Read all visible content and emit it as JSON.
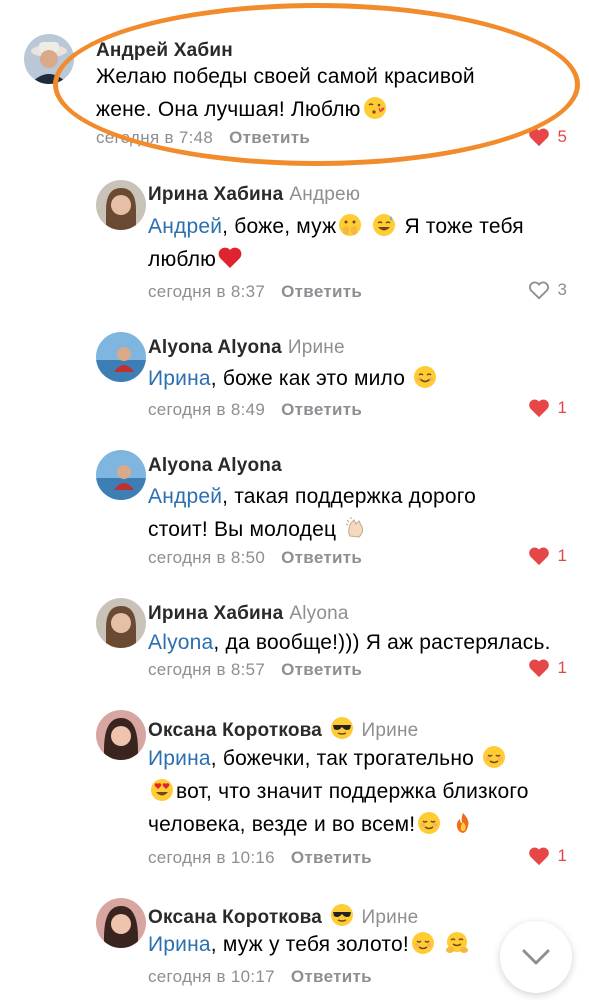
{
  "comments": [
    {
      "author": "Андрей Хабин",
      "reply_to": "",
      "mention": "",
      "text_parts": [
        "Желаю победы своей самой красивой",
        "жене. Она лучшая! Люблю"
      ],
      "time": "сегодня в 7:48",
      "reply_label": "Ответить",
      "likes": "5",
      "liked": true
    },
    {
      "author": "Ирина Хабина",
      "reply_to": "Андрею",
      "mention": "Андрей",
      "text_a": ", боже, муж",
      "text_b": "Я тоже тебя",
      "text_c": "люблю",
      "time": "сегодня в 8:37",
      "reply_label": "Ответить",
      "likes": "3",
      "liked": false
    },
    {
      "author": "Alyona Alyona",
      "reply_to": "Ирине",
      "mention": "Ирина",
      "text_a": ", боже как это мило",
      "time": "сегодня в 8:49",
      "reply_label": "Ответить",
      "likes": "1",
      "liked": true
    },
    {
      "author": "Alyona Alyona",
      "reply_to": "",
      "mention": "Андрей",
      "text_a": ", такая поддержка дорого",
      "text_b": "стоит! Вы молодец",
      "time": "сегодня в 8:50",
      "reply_label": "Ответить",
      "likes": "1",
      "liked": true
    },
    {
      "author": "Ирина Хабина",
      "reply_to": "Alyona",
      "mention": "Alyona",
      "text_a": ", да вообще!))) Я аж растерялась.",
      "time": "сегодня в 8:57",
      "reply_label": "Ответить",
      "likes": "1",
      "liked": true
    },
    {
      "author": "Оксана Короткова",
      "reply_to": "Ирине",
      "mention": "Ирина",
      "text_a": ", божечки, так трогательно",
      "text_b": "вот, что значит поддержка близкого",
      "text_c": "человека, везде и во всем!",
      "time": "сегодня в 10:16",
      "reply_label": "Ответить",
      "likes": "1",
      "liked": true
    },
    {
      "author": "Оксана Короткова",
      "reply_to": "Ирине",
      "mention": "Ирина",
      "text_a": ", муж у тебя золото!",
      "time": "сегодня в 10:17",
      "reply_label": "Ответить",
      "likes": "",
      "liked": false
    }
  ],
  "colors": {
    "mention": "#2a6fb0",
    "like_active": "#e64646",
    "meta": "#8e8e93",
    "highlight": "#f28b2b"
  },
  "icons": {
    "like": "heart-icon",
    "scroll_down": "chevron-down-icon"
  }
}
